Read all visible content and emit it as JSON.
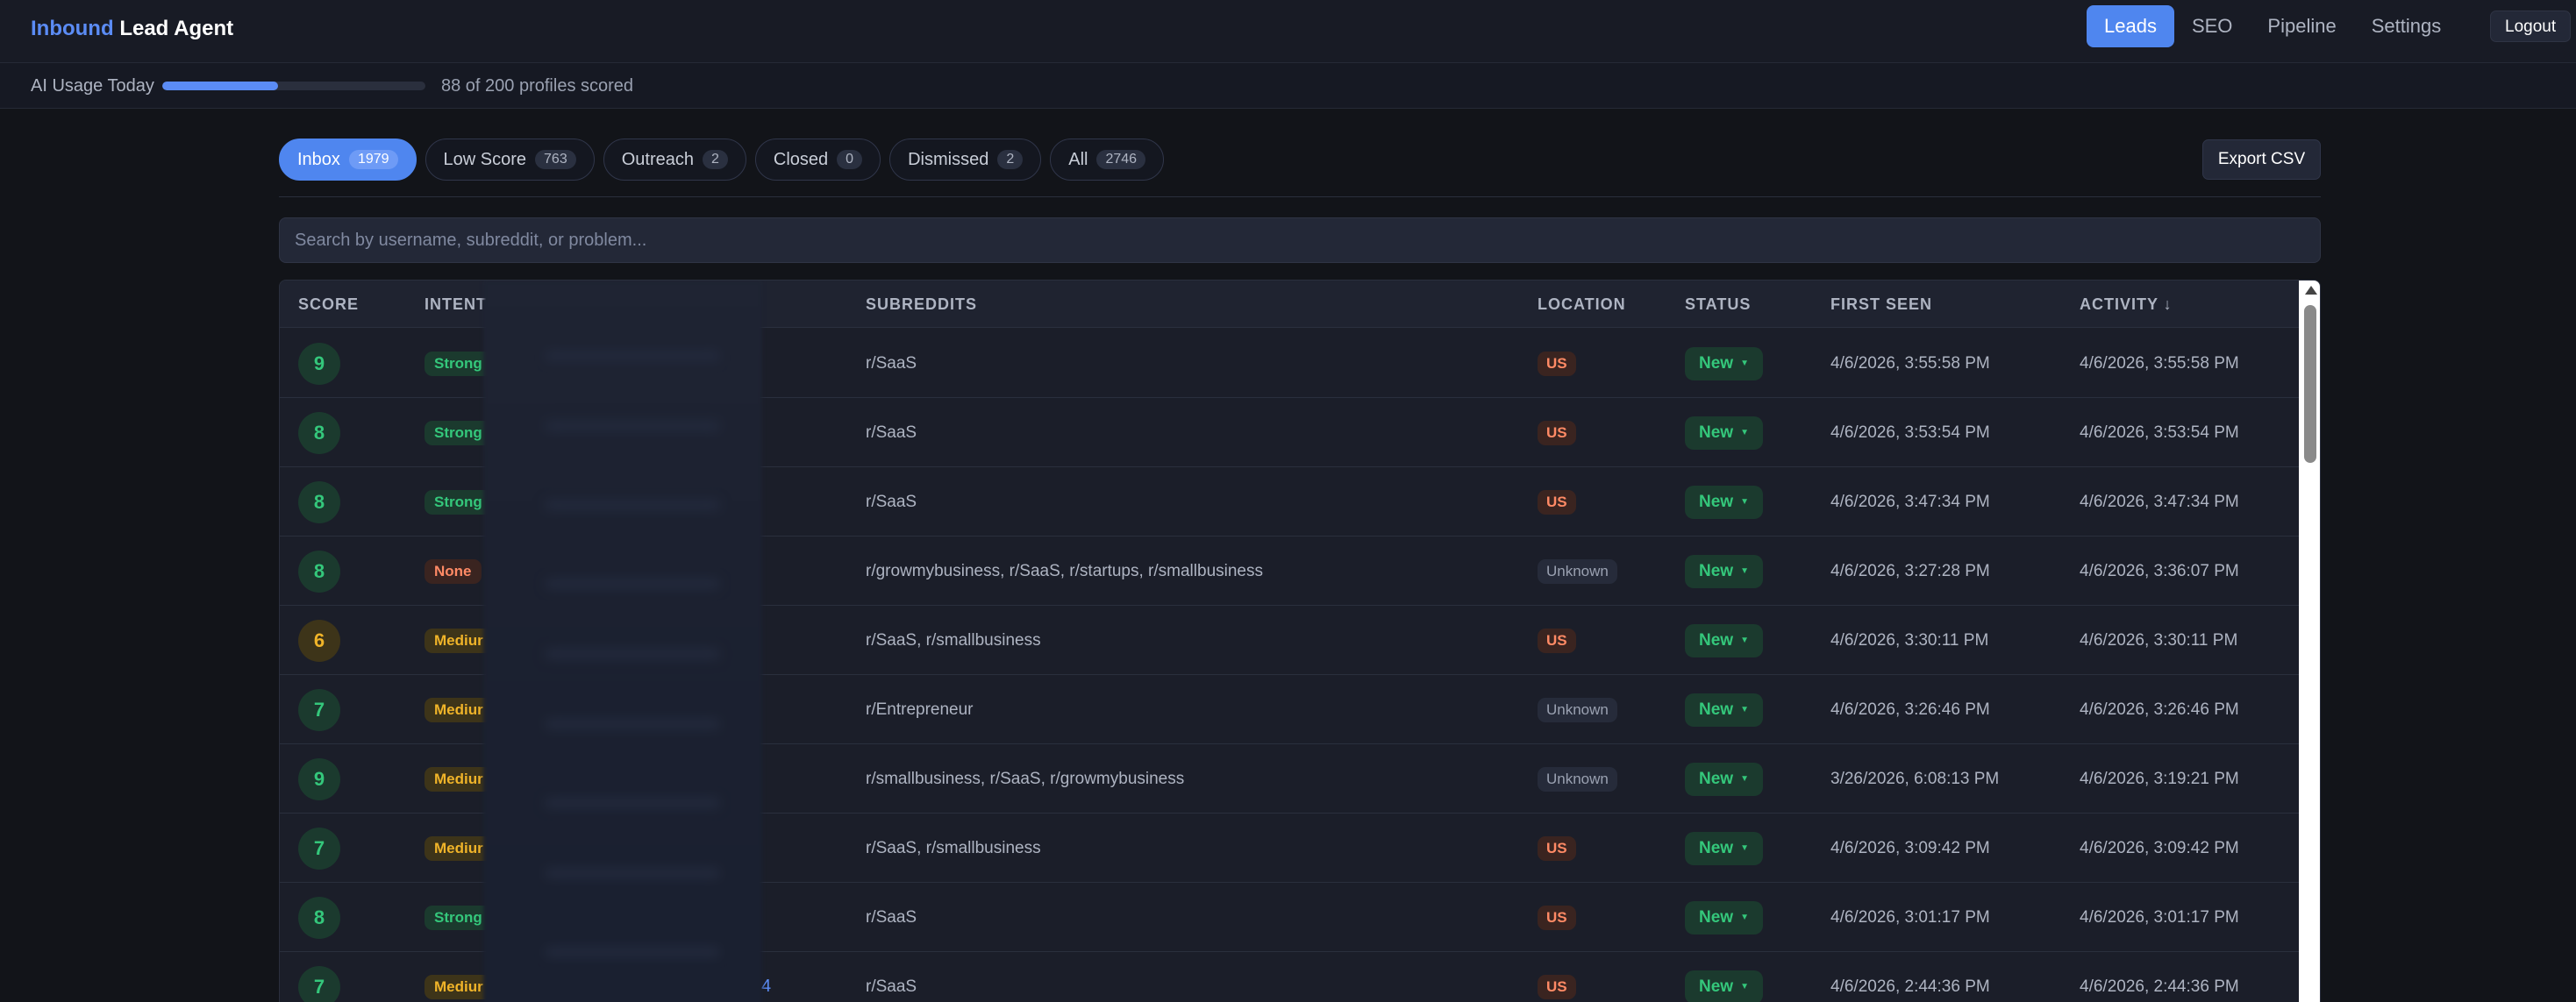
{
  "brand": {
    "accent": "Inbound",
    "rest": "Lead Agent"
  },
  "nav": {
    "items": [
      "Leads",
      "SEO",
      "Pipeline",
      "Settings"
    ],
    "active": "Leads",
    "logout": "Logout"
  },
  "usage": {
    "label": "AI Usage Today",
    "used": 88,
    "limit": 200,
    "fraction": 0.44,
    "text": "88 of 200 profiles scored"
  },
  "tabs": [
    {
      "label": "Inbox",
      "count": "1979",
      "active": true
    },
    {
      "label": "Low Score",
      "count": "763",
      "active": false
    },
    {
      "label": "Outreach",
      "count": "2",
      "active": false
    },
    {
      "label": "Closed",
      "count": "0",
      "active": false
    },
    {
      "label": "Dismissed",
      "count": "2",
      "active": false
    },
    {
      "label": "All",
      "count": "2746",
      "active": false
    }
  ],
  "export_label": "Export CSV",
  "search": {
    "placeholder": "Search by username, subreddit, or problem...",
    "value": ""
  },
  "table": {
    "headers": {
      "score": "SCORE",
      "intent": "INTENT",
      "subreddits": "SUBREDDITS",
      "location": "LOCATION",
      "status": "STATUS",
      "first_seen": "FIRST SEEN",
      "activity": "ACTIVITY ↓"
    },
    "rows": [
      {
        "score": "9",
        "score_color": "green",
        "intent": "Strong",
        "intent_type": "strong",
        "subreddits": "r/SaaS",
        "location": "US",
        "status": "New",
        "first_seen": "4/6/2026, 3:55:58 PM",
        "activity": "4/6/2026, 3:55:58 PM"
      },
      {
        "score": "8",
        "score_color": "green",
        "intent": "Strong",
        "intent_type": "strong",
        "subreddits": "r/SaaS",
        "location": "US",
        "status": "New",
        "first_seen": "4/6/2026, 3:53:54 PM",
        "activity": "4/6/2026, 3:53:54 PM"
      },
      {
        "score": "8",
        "score_color": "green",
        "intent": "Strong",
        "intent_type": "strong",
        "subreddits": "r/SaaS",
        "location": "US",
        "status": "New",
        "first_seen": "4/6/2026, 3:47:34 PM",
        "activity": "4/6/2026, 3:47:34 PM"
      },
      {
        "score": "8",
        "score_color": "green",
        "intent": "None",
        "intent_type": "none",
        "subreddits": "r/growmybusiness, r/SaaS, r/startups, r/smallbusiness",
        "location": "Unknown",
        "status": "New",
        "first_seen": "4/6/2026, 3:27:28 PM",
        "activity": "4/6/2026, 3:36:07 PM"
      },
      {
        "score": "6",
        "score_color": "amber",
        "intent": "Mediur",
        "intent_type": "medium",
        "subreddits": "r/SaaS, r/smallbusiness",
        "location": "US",
        "status": "New",
        "first_seen": "4/6/2026, 3:30:11 PM",
        "activity": "4/6/2026, 3:30:11 PM"
      },
      {
        "score": "7",
        "score_color": "green",
        "intent": "Mediur",
        "intent_type": "medium",
        "subreddits": "r/Entrepreneur",
        "location": "Unknown",
        "status": "New",
        "first_seen": "4/6/2026, 3:26:46 PM",
        "activity": "4/6/2026, 3:26:46 PM"
      },
      {
        "score": "9",
        "score_color": "green",
        "intent": "Mediur",
        "intent_type": "medium",
        "subreddits": "r/smallbusiness, r/SaaS, r/growmybusiness",
        "location": "Unknown",
        "status": "New",
        "first_seen": "3/26/2026, 6:08:13 PM",
        "activity": "4/6/2026, 3:19:21 PM"
      },
      {
        "score": "7",
        "score_color": "green",
        "intent": "Mediur",
        "intent_type": "medium",
        "subreddits": "r/SaaS, r/smallbusiness",
        "location": "US",
        "status": "New",
        "first_seen": "4/6/2026, 3:09:42 PM",
        "activity": "4/6/2026, 3:09:42 PM"
      },
      {
        "score": "8",
        "score_color": "green",
        "intent": "Strong",
        "intent_type": "strong",
        "subreddits": "r/SaaS",
        "location": "US",
        "status": "New",
        "first_seen": "4/6/2026, 3:01:17 PM",
        "activity": "4/6/2026, 3:01:17 PM"
      },
      {
        "score": "7",
        "score_color": "green",
        "intent": "Mediur",
        "intent_type": "medium",
        "subreddits": "r/SaaS",
        "location": "US",
        "status": "New",
        "first_seen": "4/6/2026, 2:44:36 PM",
        "activity": "4/6/2026, 2:44:36 PM",
        "link_suffix": "4"
      }
    ]
  },
  "colors": {
    "accent": "#4f86ef",
    "strong": "#34c77b",
    "medium": "#f0b429",
    "none": "#ff8a65",
    "background": "#121419"
  },
  "icons": {
    "status_caret": "caret-down-icon",
    "scroll_up": "arrow-up-icon"
  }
}
